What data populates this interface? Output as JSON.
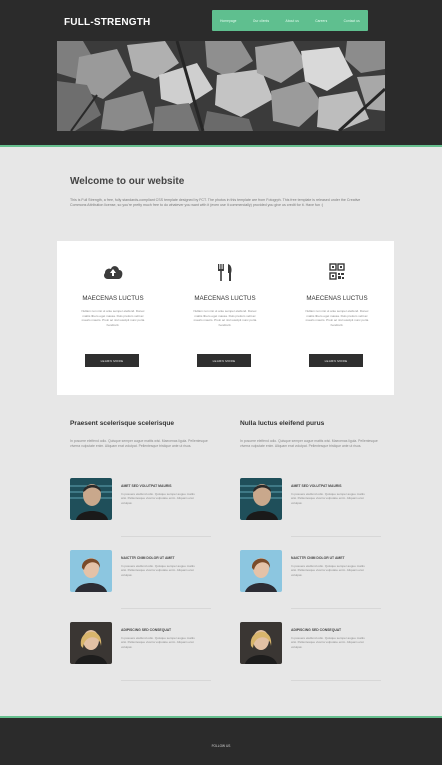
{
  "header": {
    "logo": "FULL-STRENGTH",
    "nav": [
      "Homepage",
      "Our clients",
      "About us",
      "Careers",
      "Contact us"
    ]
  },
  "welcome": {
    "title": "Welcome to our website",
    "text": "This is Full Strength, a free, fully standards-compliant CSS template designed by FCT. The photos in this template are from Fotogrph. This free template is released under the Creative Commons Attribution license, so you're pretty much free to do whatever you want with it (even use it commercially) provided you give us credit for it. Have fun :)"
  },
  "features": [
    {
      "icon": "cloud-upload-icon",
      "title": "MAECENAS LUCTUS",
      "text": "Nullam non nisi ut ante semper eleifend. Donec mattis libero eget massa. Duis pretium velit ac mauris mauris. Proin ac nisl suscipit nunc porta hendrerit.",
      "button": "LEARN MORE"
    },
    {
      "icon": "cutlery-icon",
      "title": "MAECENAS LUCTUS",
      "text": "Nullam non nisi ut ante semper eleifend. Donec mattis libero eget massa. Duis pretium velit ac mauris mauris. Proin ac nisl suscipit nunc porta hendrerit.",
      "button": "LEARN MORE"
    },
    {
      "icon": "qrcode-icon",
      "title": "MAECENAS LUCTUS",
      "text": "Nullam non nisi ut ante semper eleifend. Donec mattis libero eget massa. Duis pretium velit ac mauris mauris. Proin ac nisl suscipit nunc porta hendrerit.",
      "button": "LEARN MORE"
    }
  ],
  "columns": [
    {
      "title": "Praesent scelerisque scelerisque",
      "intro": "In posuere eleifend odio. Quisque semper augue mattis wisi. Maecenas ligula. Pellentesque viverra vulputate enim. Aliquam erat volutpat. Pellentesque tristique ante ut risus.",
      "items": [
        {
          "title": "AMET SED VOLUTPAT MAURIS",
          "text": "In posuere eleifend odio. Quisque semper augue mattis wisi. Pellentesque viverra vulputate enim. Aliquam erat volutpat."
        },
        {
          "title": "NAICTTR CNIM DOLOR UT AMET",
          "text": "In posuere eleifend odio. Quisque semper augue mattis wisi. Pellentesque viverra vulputate enim. Aliquam erat volutpat."
        },
        {
          "title": "ADIPISCING SED CONSEQUAT",
          "text": "In posuere eleifend odio. Quisque semper augue mattis wisi. Pellentesque viverra vulputate enim. Aliquam erat volutpat."
        }
      ]
    },
    {
      "title": "Nulla luctus eleifend purus",
      "intro": "In posuere eleifend odio. Quisque semper augue mattis wisi. Maecenas ligula. Pellentesque viverra vulputate enim. Aliquam erat volutpat. Pellentesque tristique ante ut risus.",
      "items": [
        {
          "title": "AMET SED VOLUTPAT MAURIS",
          "text": "In posuere eleifend odio. Quisque semper augue mattis wisi. Pellentesque viverra vulputate enim. Aliquam erat volutpat."
        },
        {
          "title": "NAICTTR CNIM DOLOR UT AMET",
          "text": "In posuere eleifend odio. Quisque semper augue mattis wisi. Pellentesque viverra vulputate enim. Aliquam erat volutpat."
        },
        {
          "title": "ADIPISCING SED CONSEQUAT",
          "text": "In posuere eleifend odio. Quisque semper augue mattis wisi. Pellentesque viverra vulputate enim. Aliquam erat volutpat."
        }
      ]
    }
  ],
  "footer": {
    "text": "FOLLOW US"
  },
  "colors": {
    "accent": "#5fbf8f",
    "dark": "#2b2b2b",
    "page": "#e7e7e7"
  }
}
